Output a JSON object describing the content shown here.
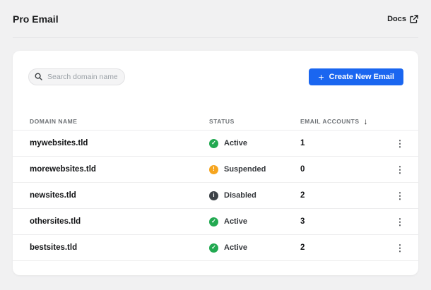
{
  "page": {
    "title": "Pro Email"
  },
  "header": {
    "docs_label": "Docs"
  },
  "toolbar": {
    "search_placeholder": "Search domain name",
    "search_value": "",
    "create_button_label": "Create New Email"
  },
  "table": {
    "columns": {
      "domain": "Domain Name",
      "status": "Status",
      "accounts": "Email Accounts"
    },
    "sort": {
      "column": "Email Accounts",
      "direction": "descending"
    },
    "rows": [
      {
        "domain": "mywebsites.tld",
        "status_label": "Active",
        "status_type": "active",
        "accounts": "1"
      },
      {
        "domain": "morewebsites.tld",
        "status_label": "Suspended",
        "status_type": "suspended",
        "accounts": "0"
      },
      {
        "domain": "newsites.tld",
        "status_label": "Disabled",
        "status_type": "disabled",
        "accounts": "2"
      },
      {
        "domain": "othersites.tld",
        "status_label": "Active",
        "status_type": "active",
        "accounts": "3"
      },
      {
        "domain": "bestsites.tld",
        "status_label": "Active",
        "status_type": "active",
        "accounts": "2"
      }
    ]
  },
  "icons": {
    "plus": "+",
    "sort_desc": "↓",
    "kebab": "⋮",
    "check": "✓",
    "exclamation": "!",
    "info": "i"
  },
  "colors": {
    "page_background": "#f1f1f2",
    "card_background": "#ffffff",
    "primary_blue": "#1a66f0",
    "status_active_green": "#22a951",
    "status_suspended_orange": "#f6a51f",
    "status_disabled_gray": "#3c4247",
    "divider": "#ededee",
    "muted_text": "#6e7276"
  }
}
